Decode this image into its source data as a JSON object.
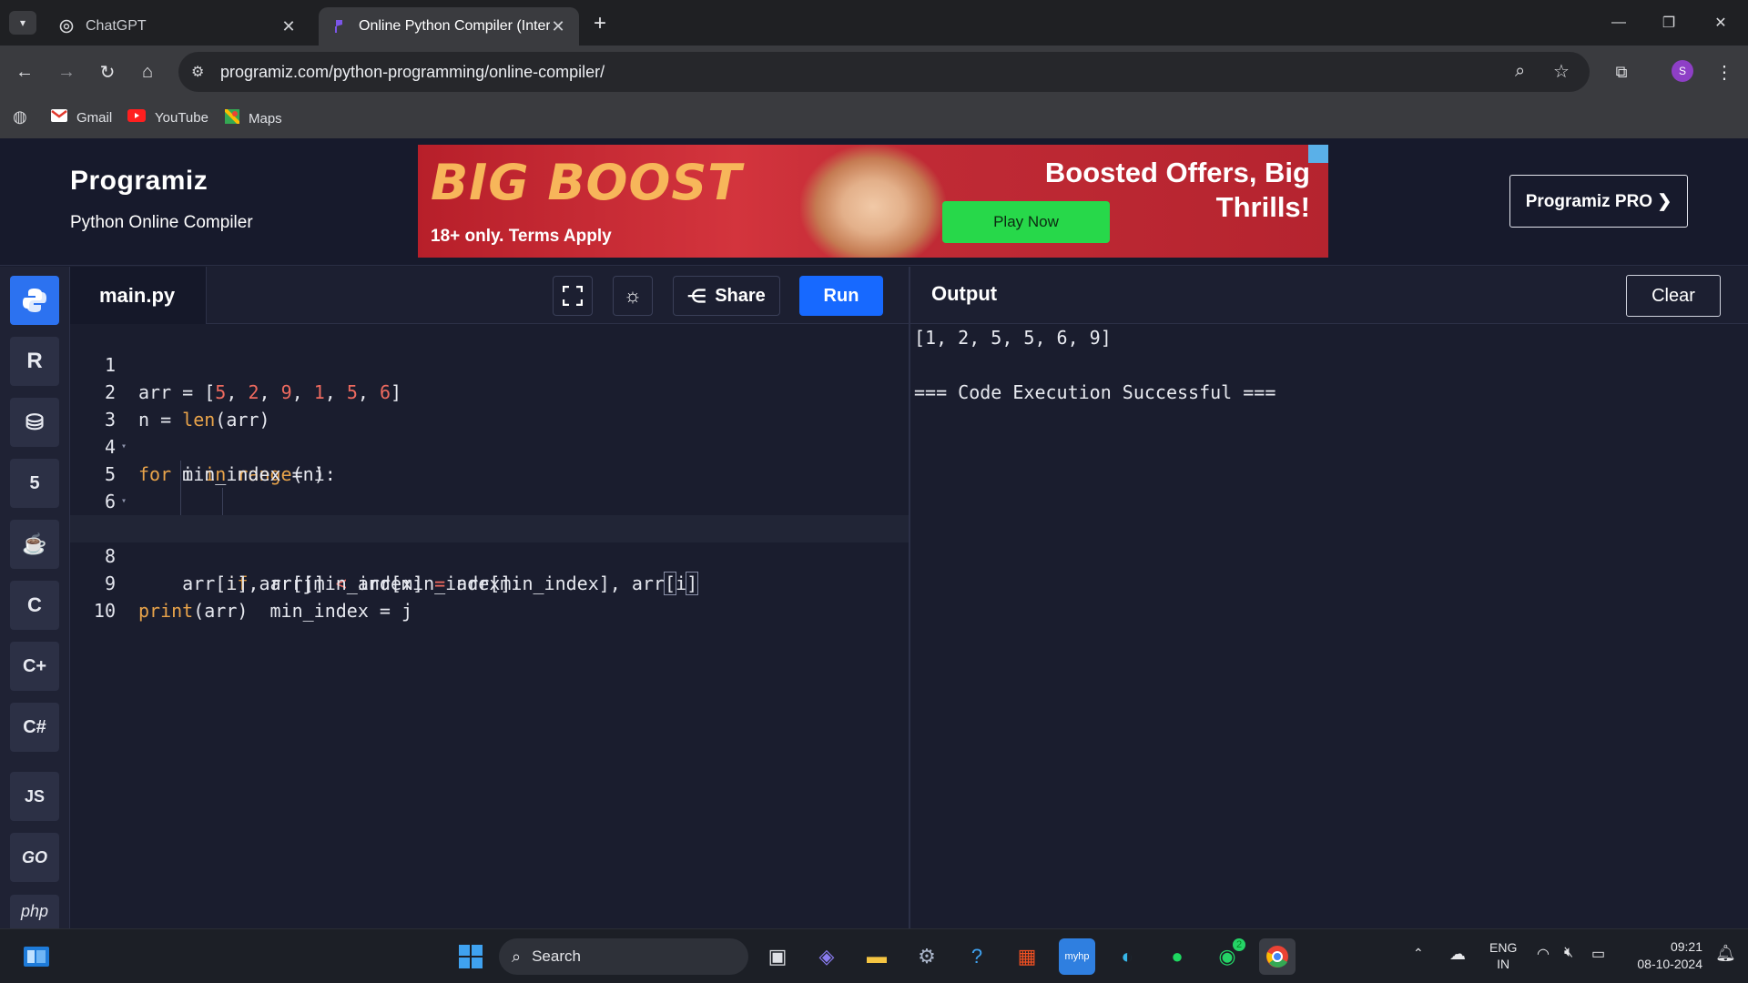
{
  "browser": {
    "tabs": [
      {
        "title": "ChatGPT",
        "active": false
      },
      {
        "title": "Online Python Compiler (Interp",
        "active": true
      }
    ],
    "url": "programiz.com/python-programming/online-compiler/",
    "bookmarks": [
      {
        "label": "Gmail",
        "icon": "gmail-icon"
      },
      {
        "label": "YouTube",
        "icon": "youtube-icon"
      },
      {
        "label": "Maps",
        "icon": "maps-icon"
      }
    ],
    "profile_initial": "S"
  },
  "site": {
    "logo": "Programiz",
    "subtitle": "Python Online Compiler",
    "pro_button": "Programiz PRO ❯",
    "ad": {
      "big_text": "BIG BOOST",
      "terms": "18+ only. Terms Apply",
      "headline": "Boosted Offers, Big Thrills!",
      "cta": "Play Now"
    }
  },
  "languages": [
    "python",
    "r",
    "sql",
    "html",
    "java",
    "c",
    "cpp",
    "csharp",
    "JS",
    "GO",
    "php"
  ],
  "editor": {
    "filename": "main.py",
    "share_label": "Share",
    "run_label": "Run",
    "lines": [
      "arr = [5, 2, 9, 1, 5, 6]",
      "n = len(arr)",
      "for i in range(n):",
      "    min_index = i",
      "    for j in range(i + 1, n):",
      "        if arr[j] < arr[min_index]:",
      "            min_index = j",
      "    arr[i], arr[min_index] = arr[min_index], arr[i]",
      "print(arr)",
      ""
    ]
  },
  "output": {
    "title": "Output",
    "clear_label": "Clear",
    "lines": [
      "[1, 2, 5, 5, 6, 9]",
      "",
      "=== Code Execution Successful ==="
    ]
  },
  "taskbar": {
    "search_placeholder": "Search",
    "lang": "ENG",
    "region": "IN",
    "time": "09:21",
    "date": "08-10-2024",
    "whatsapp_badge": "2"
  },
  "colors": {
    "accent_blue": "#1769ff",
    "keyword": "#e8a34a",
    "number": "#ee6a5f",
    "editor_bg": "#1a1d2e"
  }
}
